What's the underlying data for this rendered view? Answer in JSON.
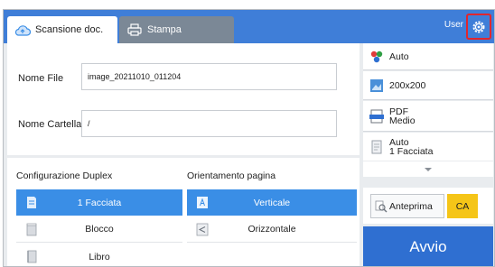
{
  "tabs": {
    "scan_label": "Scansione doc.",
    "print_label": "Stampa"
  },
  "header": {
    "user_label": "User"
  },
  "form": {
    "filename_label": "Nome File",
    "filename_value": "image_20211010_011204",
    "folder_label": "Nome Cartella",
    "folder_value": "/"
  },
  "duplex": {
    "title": "Configurazione Duplex",
    "options": [
      "1 Facciata",
      "Blocco",
      "Libro"
    ],
    "selected": "1 Facciata"
  },
  "orientation": {
    "title": "Orientamento pagina",
    "options": [
      "Verticale",
      "Orizzontale"
    ],
    "selected": "Verticale"
  },
  "settings": {
    "color": "Auto",
    "resolution": "200x200",
    "format_line1": "PDF",
    "format_line2": "Medio",
    "size_line1": "Auto",
    "size_line2": "1 Facciata"
  },
  "actions": {
    "preview_label": "Anteprima",
    "ca_label": "CA",
    "start_label": "Avvio"
  },
  "colors": {
    "topbar": "#3f7ed8",
    "selected": "#3a8ee6",
    "start": "#2f6fd1",
    "ca": "#f5c518",
    "highlight": "#e0262e"
  }
}
